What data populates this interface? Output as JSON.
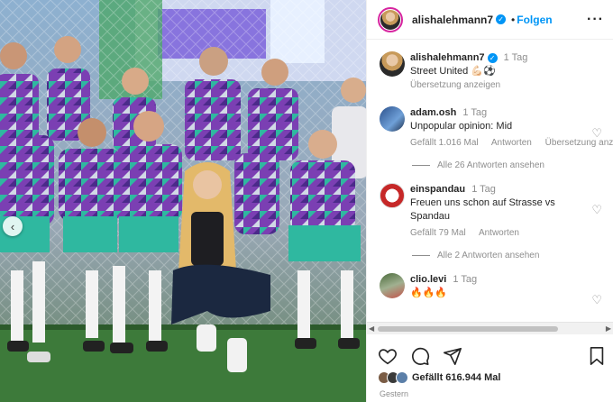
{
  "post": {
    "author": "alishalehmann7",
    "follow_label": "Folgen",
    "more_icon": "more-horizontal-icon"
  },
  "caption": {
    "author": "alishalehmann7",
    "time": "1 Tag",
    "text": "Street United 💪🏻⚽",
    "translate": "Übersetzung anzeigen"
  },
  "comments": [
    {
      "author": "adam.osh",
      "time": "1 Tag",
      "text": "Unpopular opinion: Mid",
      "likes": "Gefällt 1.016 Mal",
      "reply": "Antworten",
      "translate": "Übersetzung anz",
      "view_replies": "Alle 26 Antworten ansehen"
    },
    {
      "author": "einspandau",
      "time": "1 Tag",
      "text_line1": "Freuen uns schon auf Strasse vs",
      "text_line2": "Spandau",
      "likes": "Gefällt 79 Mal",
      "reply": "Antworten",
      "view_replies": "Alle 2 Antworten ansehen"
    },
    {
      "author": "clio.levi",
      "time": "1 Tag",
      "text": "🔥🔥🔥"
    }
  ],
  "engagement": {
    "likes": "Gefällt 616.944 Mal",
    "date": "Gestern"
  },
  "colors": {
    "accent": "#0095f6",
    "jersey_purple": "#7b3fb3",
    "jersey_teal": "#2fb8a0",
    "grass": "#3d7a3a"
  }
}
